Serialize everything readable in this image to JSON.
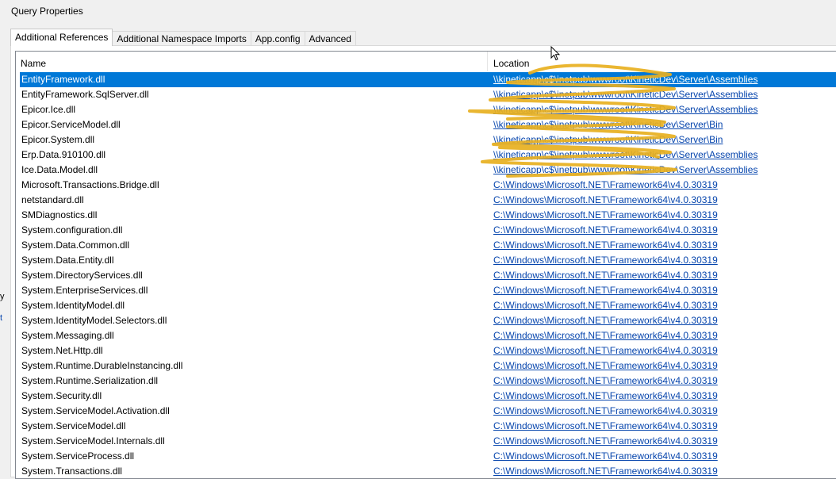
{
  "window": {
    "title": "Query Properties"
  },
  "tabs": [
    {
      "label": "Additional References",
      "active": true
    },
    {
      "label": "Additional Namespace Imports",
      "active": false
    },
    {
      "label": "App.config",
      "active": false
    },
    {
      "label": "Advanced",
      "active": false
    }
  ],
  "columns": {
    "name": "Name",
    "location": "Location"
  },
  "rows": [
    {
      "name": "EntityFramework.dll",
      "location": "\\\\kineticapp\\c$\\inetpub\\wwwroot\\KineticDev\\Server\\Assemblies",
      "selected": true
    },
    {
      "name": "EntityFramework.SqlServer.dll",
      "location": "\\\\kineticapp\\c$\\inetpub\\wwwroot\\KineticDev\\Server\\Assemblies"
    },
    {
      "name": "Epicor.Ice.dll",
      "location": "\\\\kineticapp\\c$\\inetpub\\wwwroot\\KineticDev\\Server\\Assemblies"
    },
    {
      "name": "Epicor.ServiceModel.dll",
      "location": "\\\\kineticapp\\c$\\inetpub\\wwwroot\\KineticDev\\Server\\Bin"
    },
    {
      "name": "Epicor.System.dll",
      "location": "\\\\kineticapp\\c$\\inetpub\\wwwroot\\KineticDev\\Server\\Bin"
    },
    {
      "name": "Erp.Data.910100.dll",
      "location": "\\\\kineticapp\\c$\\inetpub\\wwwroot\\KineticDev\\Server\\Assemblies"
    },
    {
      "name": "Ice.Data.Model.dll",
      "location": "\\\\kineticapp\\c$\\inetpub\\wwwroot\\KineticDev\\Server\\Assemblies"
    },
    {
      "name": "Microsoft.Transactions.Bridge.dll",
      "location": "C:\\Windows\\Microsoft.NET\\Framework64\\v4.0.30319"
    },
    {
      "name": "netstandard.dll",
      "location": "C:\\Windows\\Microsoft.NET\\Framework64\\v4.0.30319"
    },
    {
      "name": "SMDiagnostics.dll",
      "location": "C:\\Windows\\Microsoft.NET\\Framework64\\v4.0.30319"
    },
    {
      "name": "System.configuration.dll",
      "location": "C:\\Windows\\Microsoft.NET\\Framework64\\v4.0.30319"
    },
    {
      "name": "System.Data.Common.dll",
      "location": "C:\\Windows\\Microsoft.NET\\Framework64\\v4.0.30319"
    },
    {
      "name": "System.Data.Entity.dll",
      "location": "C:\\Windows\\Microsoft.NET\\Framework64\\v4.0.30319"
    },
    {
      "name": "System.DirectoryServices.dll",
      "location": "C:\\Windows\\Microsoft.NET\\Framework64\\v4.0.30319"
    },
    {
      "name": "System.EnterpriseServices.dll",
      "location": "C:\\Windows\\Microsoft.NET\\Framework64\\v4.0.30319"
    },
    {
      "name": "System.IdentityModel.dll",
      "location": "C:\\Windows\\Microsoft.NET\\Framework64\\v4.0.30319"
    },
    {
      "name": "System.IdentityModel.Selectors.dll",
      "location": "C:\\Windows\\Microsoft.NET\\Framework64\\v4.0.30319"
    },
    {
      "name": "System.Messaging.dll",
      "location": "C:\\Windows\\Microsoft.NET\\Framework64\\v4.0.30319"
    },
    {
      "name": "System.Net.Http.dll",
      "location": "C:\\Windows\\Microsoft.NET\\Framework64\\v4.0.30319"
    },
    {
      "name": "System.Runtime.DurableInstancing.dll",
      "location": "C:\\Windows\\Microsoft.NET\\Framework64\\v4.0.30319"
    },
    {
      "name": "System.Runtime.Serialization.dll",
      "location": "C:\\Windows\\Microsoft.NET\\Framework64\\v4.0.30319"
    },
    {
      "name": "System.Security.dll",
      "location": "C:\\Windows\\Microsoft.NET\\Framework64\\v4.0.30319"
    },
    {
      "name": "System.ServiceModel.Activation.dll",
      "location": "C:\\Windows\\Microsoft.NET\\Framework64\\v4.0.30319"
    },
    {
      "name": "System.ServiceModel.dll",
      "location": "C:\\Windows\\Microsoft.NET\\Framework64\\v4.0.30319"
    },
    {
      "name": "System.ServiceModel.Internals.dll",
      "location": "C:\\Windows\\Microsoft.NET\\Framework64\\v4.0.30319"
    },
    {
      "name": "System.ServiceProcess.dll",
      "location": "C:\\Windows\\Microsoft.NET\\Framework64\\v4.0.30319"
    },
    {
      "name": "System.Transactions.dll",
      "location": "C:\\Windows\\Microsoft.NET\\Framework64\\v4.0.30319"
    }
  ],
  "background_fragments": {
    "left_y": "y",
    "left_t": "t"
  },
  "colors": {
    "selection": "#0078d7",
    "link": "#0645ad",
    "redaction": "#e8b020"
  },
  "icons": {
    "cursor": "mouse-pointer-icon"
  }
}
